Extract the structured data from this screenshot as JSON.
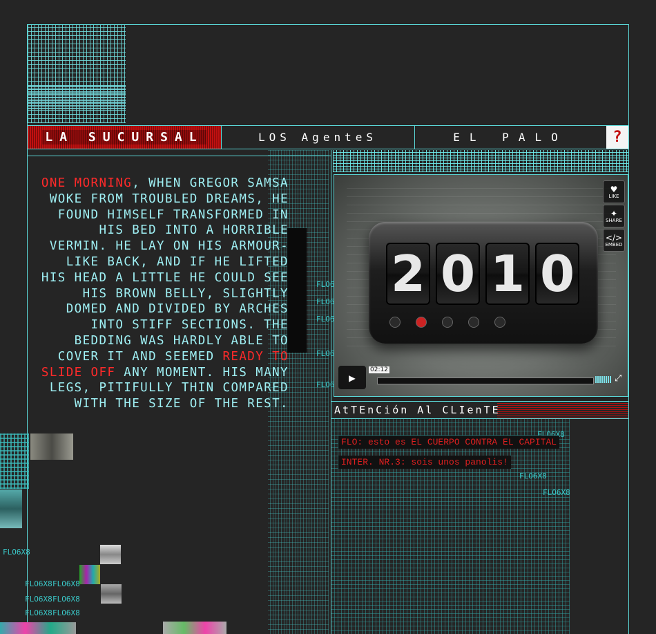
{
  "nav": {
    "item1": "LA SUCURSAL",
    "item2": "LOS AgenteS",
    "item3": "EL PALO",
    "help": "?"
  },
  "story": {
    "red1": "ONE MORNING",
    "text1": ", WHEN GREGOR SAMSA WOKE FROM TROUBLED DREAMS, HE FOUND HIMSELF TRANSFORMED IN HIS BED INTO A HORRIBLE VERMIN. HE LAY ON HIS ARMOUR-LIKE BACK, AND IF HE LIFTED HIS HEAD A LITTLE HE COULD SEE HIS BROWN BELLY, SLIGHTLY DOMED AND DIVIDED BY ARCHES INTO STIFF SECTIONS. THE BEDDING WAS HARDLY ABLE TO COVER IT AND SEEMED ",
    "red2": "READY TO SLIDE OFF",
    "text2": " ANY MOMENT. HIS MANY LEGS, PITIFULLY THIN COMPARED WITH THE SIZE OF THE REST."
  },
  "video": {
    "digits": [
      "2",
      "0",
      "1",
      "0"
    ],
    "like": "LIKE",
    "share": "SHARE",
    "embed": "EMBED",
    "time": "02:12",
    "progress": 0
  },
  "chat": {
    "title": "AtTEnCión Al CLIenTE",
    "messages": [
      "FLO: esto es EL CUERPO CONTRA EL CAPITAL",
      "INTER. NR.3: sois unos panolis!"
    ]
  },
  "noise_text": "FLO6X8",
  "colors": {
    "accent": "#5ad6d6",
    "red": "#ff2a2a",
    "text": "#9ff0f4"
  }
}
